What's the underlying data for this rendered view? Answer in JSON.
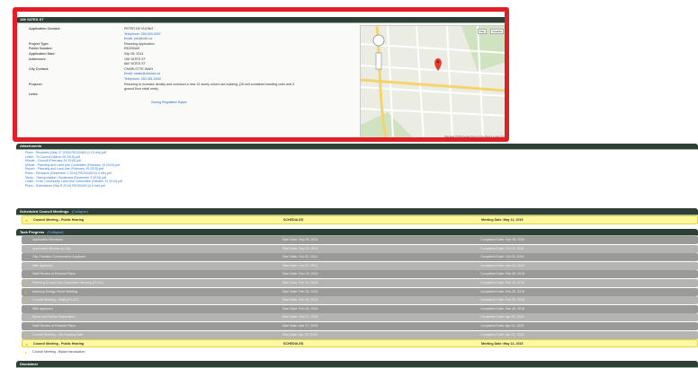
{
  "detail": {
    "header": "158 YATES ST",
    "fields": [
      {
        "label": "Application Contact:",
        "value": "PETER DE VUONO"
      },
      {
        "label": "",
        "value": "Telephone: 250-000-0097"
      },
      {
        "label": "",
        "value": "Email: pdv@cdtl.ca"
      },
      {
        "label": "Project Type:",
        "value": "Rezoning Application"
      },
      {
        "label": "Folder Number:",
        "value": "REZ00463"
      },
      {
        "label": "Application Date:",
        "value": "Sep 05, 2014"
      },
      {
        "label": "Addresses:",
        "value": "158 YATES ST"
      },
      {
        "label": "",
        "value": "660 YATES ST"
      },
      {
        "label": "City Contact:",
        "value": "CHARLOTTE WAIN"
      },
      {
        "label": "",
        "value": "Email: cwain@victoria.ca"
      },
      {
        "label": "",
        "value": "Telephone: 250-361-0340"
      },
      {
        "label": "Purpose:",
        "value": "Rezoning to increase density and construct a new 13 storey mixed use building, (28 self-contained dwelling units and 3"
      },
      {
        "label": "",
        "value": "ground floor retail units)."
      },
      {
        "label": "Links:",
        "value": ""
      },
      {
        "label": "",
        "value": "Zoning Regulation Bylaw"
      }
    ],
    "map_type": "Map",
    "map_type2": "Satellite",
    "map_footer": "Map data ©2015 Google   Terms of Use   Report a map error"
  },
  "attachments": {
    "header": "Attachments",
    "items": [
      "Plans - Revisions (May 27 2015) REZ00463 (1.01 mb).pdf",
      "Letter - To Council (March 26 2015).pdf",
      "Minute - Council (February 26 2015).pdf",
      "Minute - Planning and Land Use Committee (February 19 2015).pdf",
      "Report - Planning and Land Use (February 19 2015).pdf",
      "Plans - Revisions (December 2 2014) REZ00463 (4.4 mb).pdf",
      "Study - Transportation / Boulevard (December 3 2014).pdf",
      "Letter - From Community Land Use Committee (October 23 2014).pdf",
      "Plans - Submission (Sep 8 2014) REZ00463 (4.4 mb).pdf"
    ]
  },
  "meetings": {
    "header": "Scheduled Council Meetings",
    "collapse": "(Collapse)",
    "row": {
      "name": "Council Meeting - Public Hearing",
      "status": "SCHEDULED",
      "date": "Meeting Date: May 14, 2015"
    }
  },
  "tasks": {
    "header": "Task Progress",
    "collapse": "(Collapse)",
    "rows": [
      {
        "arrow": false,
        "hl": false,
        "name": "Application Received",
        "start": "Start Date: Sep 05, 2014",
        "done": "Completed Date: Sep 05, 2014"
      },
      {
        "arrow": false,
        "hl": false,
        "name": "Application Review by City",
        "start": "Start Date: Sep 10, 2014",
        "done": "Completed Date: Oct 03, 2014"
      },
      {
        "arrow": false,
        "hl": false,
        "name": "City Provides Comments to Applicant",
        "start": "Start Date: Oct 03, 2014",
        "done": "Completed Date: Oct 03, 2014"
      },
      {
        "arrow": false,
        "hl": false,
        "name": "With applicant",
        "start": "Start Date: Oct 03, 2014",
        "done": "Completed Date: Dec 03, 2014"
      },
      {
        "arrow": false,
        "hl": false,
        "name": "Staff Review of Revised Plans",
        "start": "Start Date: Dec 03, 2014",
        "done": "Completed Date: Feb 05, 2015"
      },
      {
        "arrow": true,
        "hl": false,
        "name": "Planning & Land Use Committee Meeting (PLUC)",
        "start": "Start Date: Feb 19, 2015",
        "done": "Completed Date: Feb 19, 2015"
      },
      {
        "arrow": true,
        "hl": false,
        "name": "Advisory Design Panel Meeting",
        "start": "Start Date: Feb 25, 2015",
        "done": "Completed Date: Feb 25, 2015"
      },
      {
        "arrow": true,
        "hl": false,
        "name": "Council Meeting - Ratify (PLUC)",
        "start": "Start Date: Feb 26, 2015",
        "done": "Completed Date: Feb 26, 2015"
      },
      {
        "arrow": false,
        "hl": false,
        "name": "With applicant",
        "start": "Start Date: Feb 26, 2015",
        "done": "Completed Date: Mar 26, 2015"
      },
      {
        "arrow": false,
        "hl": false,
        "name": "Bylaw and Notice Preparation",
        "start": "Start Date: Feb 27, 2015",
        "done": "Completed Date: Apr 09, 2015"
      },
      {
        "arrow": false,
        "hl": false,
        "name": "Staff Review of Revised Plans",
        "start": "Start Date: Mar 27, 2015",
        "done": "Completed Date: Apr 23, 2015"
      },
      {
        "arrow": true,
        "hl": false,
        "name": "Council Meeting - Set Hearing Date",
        "start": "Start Date: Apr 23, 2015",
        "done": "Completed Date: Apr 23, 2015"
      },
      {
        "arrow": true,
        "hl": true,
        "name": "Council Meeting - Public Hearing",
        "start": "SCHEDULED",
        "done": "Meeting Date: May 14, 2015"
      },
      {
        "arrow": true,
        "hl": false,
        "white": true,
        "name": "Council Meeting - Bylaw Introduction",
        "start": "",
        "done": ""
      }
    ]
  },
  "disclaimer": {
    "header": "Disclaimer"
  }
}
